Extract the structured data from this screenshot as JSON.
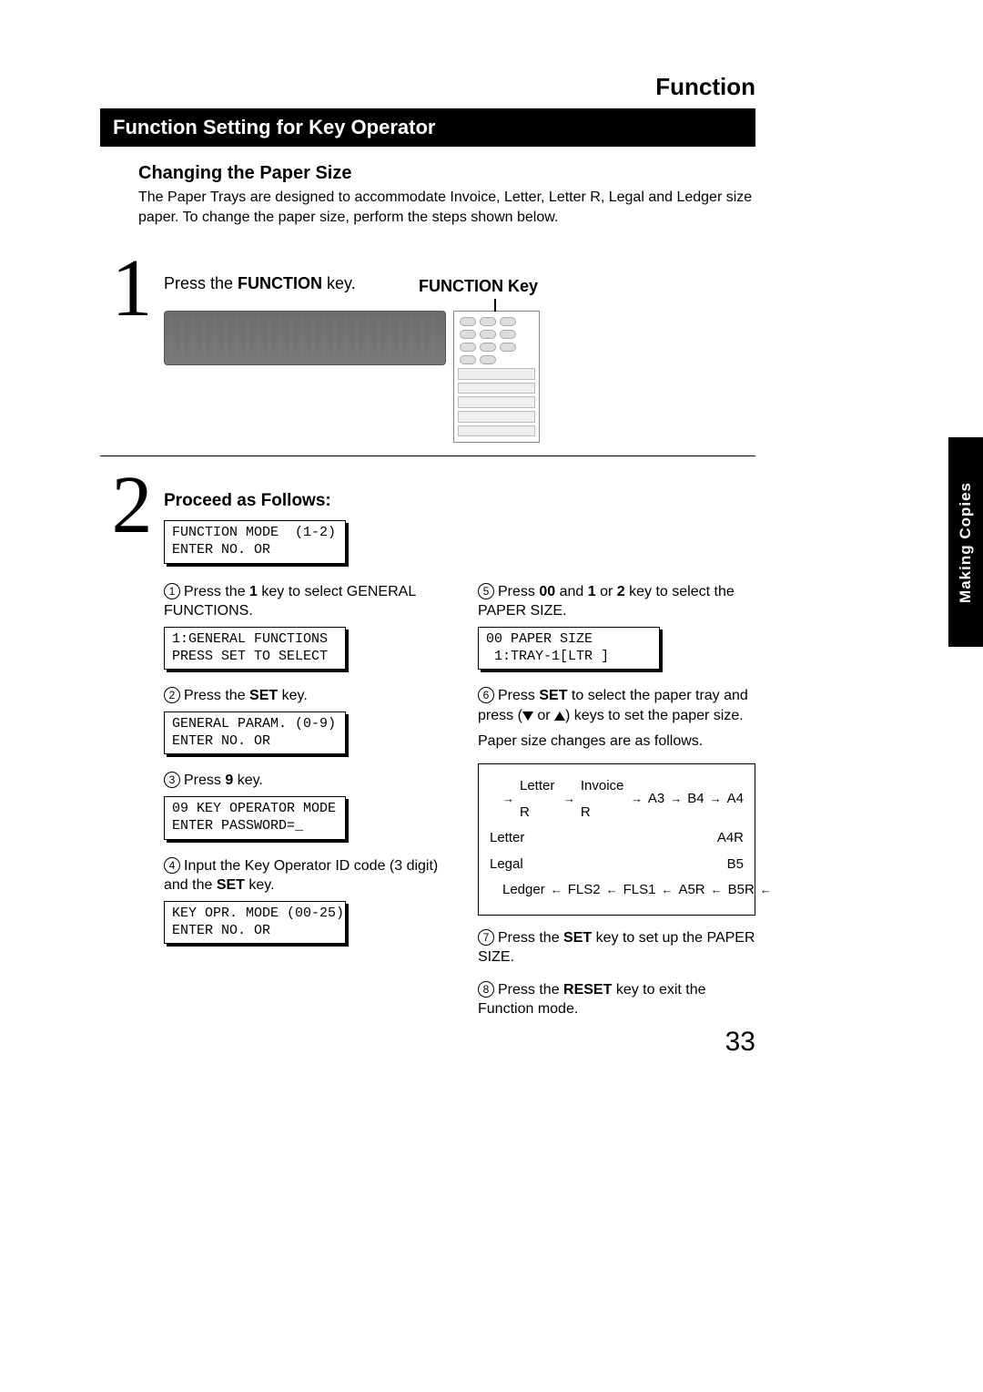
{
  "header": {
    "section": "Function"
  },
  "bar_title": "Function Setting for Key Operator",
  "sub_title": "Changing the Paper Size",
  "intro": "The Paper Trays are designed to accommodate Invoice, Letter, Letter R, Legal and Ledger size paper. To change the paper size, perform the steps shown below.",
  "steps": {
    "one": {
      "text_pre": "Press the ",
      "text_key": "FUNCTION",
      "text_post": " key.",
      "key_label_pre": "FUNCTION",
      "key_label_post": " Key"
    },
    "two": {
      "title": "Proceed as Follows:",
      "lcd0": "FUNCTION MODE  (1-2)\nENTER NO. OR",
      "left": [
        {
          "n": "1",
          "text_pre": "Press the ",
          "text_key": "1",
          "text_post": " key to select GENERAL FUNCTIONS.",
          "lcd": "1:GENERAL FUNCTIONS\nPRESS SET TO SELECT"
        },
        {
          "n": "2",
          "text_pre": "Press the ",
          "text_key": "SET",
          "text_post": " key.",
          "lcd": "GENERAL PARAM. (0-9)\nENTER NO. OR"
        },
        {
          "n": "3",
          "text_pre": "Press ",
          "text_key": "9",
          "text_post": " key.",
          "lcd": "09 KEY OPERATOR MODE\nENTER PASSWORD=_"
        },
        {
          "n": "4",
          "text_pre": "Input the Key Operator ID code (3 digit) and the ",
          "text_key": "SET",
          "text_post": " key.",
          "lcd": "KEY OPR. MODE (00-25)\nENTER NO. OR"
        }
      ],
      "right": [
        {
          "n": "5",
          "text_pre": "Press ",
          "text_key": "00",
          "text_mid": " and ",
          "text_key2": "1",
          "text_mid2": " or ",
          "text_key3": "2",
          "text_post": " key to select the PAPER SIZE.",
          "lcd": "00 PAPER SIZE\n 1:TRAY-1[LTR ]"
        },
        {
          "n": "6",
          "text_pre": "Press ",
          "text_key": "SET",
          "text_post": " to select the paper tray and press (▼ or ▲) keys to set the paper size.",
          "extra": "Paper size changes are as follows."
        },
        {
          "n": "7",
          "text_pre": "Press the ",
          "text_key": "SET",
          "text_post": " key to set up the PAPER SIZE."
        },
        {
          "n": "8",
          "text_pre": "Press the ",
          "text_key": "RESET",
          "text_post": " key to exit the Function mode."
        }
      ],
      "cycle": {
        "row_top": [
          "Letter R",
          "Invoice R",
          "A3",
          "B4",
          "A4"
        ],
        "left_col": [
          "Letter",
          "Legal"
        ],
        "right_col": [
          "A4R",
          "B5"
        ],
        "row_bottom": [
          "Ledger",
          "FLS2",
          "FLS1",
          "A5R",
          "B5R"
        ]
      }
    }
  },
  "side_tab": "Making Copies",
  "page_number": "33"
}
